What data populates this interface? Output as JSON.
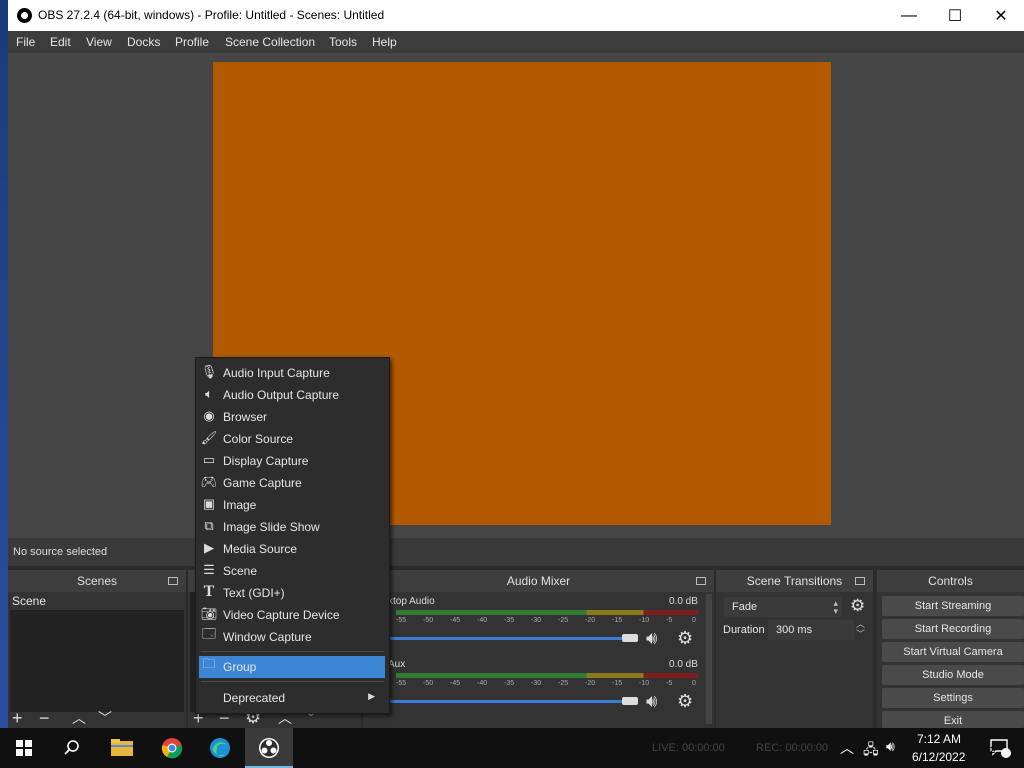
{
  "window": {
    "title": "OBS 27.2.4 (64-bit, windows) - Profile: Untitled - Scenes: Untitled"
  },
  "menubar": [
    "File",
    "Edit",
    "View",
    "Docks",
    "Profile",
    "Scene Collection",
    "Tools",
    "Help"
  ],
  "status": {
    "no_source": "No source selected"
  },
  "scenes": {
    "title": "Scenes",
    "items": [
      "Scene"
    ]
  },
  "context_menu": {
    "items": [
      {
        "label": "Audio Input Capture",
        "icon": "microphone-icon"
      },
      {
        "label": "Audio Output Capture",
        "icon": "speaker-icon"
      },
      {
        "label": "Browser",
        "icon": "globe-icon"
      },
      {
        "label": "Color Source",
        "icon": "brush-icon"
      },
      {
        "label": "Display Capture",
        "icon": "monitor-icon"
      },
      {
        "label": "Game Capture",
        "icon": "gamepad-icon"
      },
      {
        "label": "Image",
        "icon": "image-icon"
      },
      {
        "label": "Image Slide Show",
        "icon": "slideshow-icon"
      },
      {
        "label": "Media Source",
        "icon": "play-icon"
      },
      {
        "label": "Scene",
        "icon": "list-icon"
      },
      {
        "label": "Text (GDI+)",
        "icon": "text-icon"
      },
      {
        "label": "Video Capture Device",
        "icon": "camera-icon"
      },
      {
        "label": "Window Capture",
        "icon": "window-icon"
      }
    ],
    "group": "Group",
    "deprecated": "Deprecated"
  },
  "mixer": {
    "title": "Audio Mixer",
    "channels": [
      {
        "name": "ktop Audio",
        "db": "0.0 dB"
      },
      {
        "name": "Aux",
        "db": "0.0 dB"
      }
    ],
    "ticks": [
      "-55",
      "-50",
      "-45",
      "-40",
      "-35",
      "-30",
      "-25",
      "-20",
      "-15",
      "-10",
      "-5",
      "0"
    ]
  },
  "transitions": {
    "title": "Scene Transitions",
    "type": "Fade",
    "duration_label": "Duration",
    "duration_value": "300 ms"
  },
  "controls": {
    "title": "Controls",
    "buttons": [
      "Start Streaming",
      "Start Recording",
      "Start Virtual Camera",
      "Studio Mode",
      "Settings",
      "Exit"
    ]
  },
  "statusbar": {
    "live": "LIVE: 00:00:00",
    "rec": "REC: 00:00:00"
  },
  "taskbar": {
    "time": "7:12 AM",
    "date": "6/12/2022",
    "notifications": "2"
  },
  "colors": {
    "canvas": "#b35a00",
    "selection": "#3d86d6"
  }
}
